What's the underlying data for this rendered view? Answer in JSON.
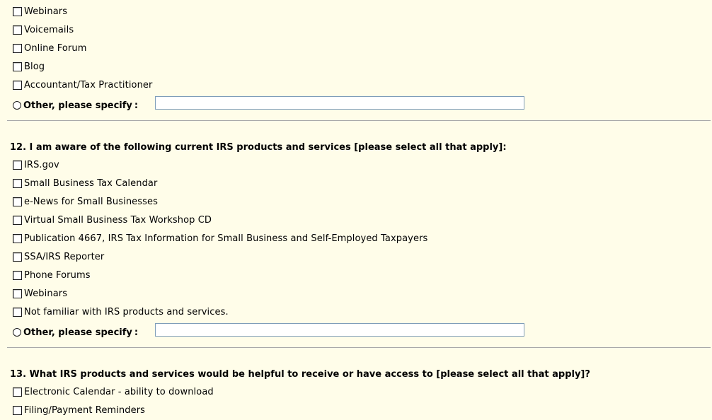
{
  "section_prev": {
    "items": [
      "Webinars",
      "Voicemails",
      "Online Forum",
      "Blog",
      "Accountant/Tax Practitioner"
    ],
    "other_label": "Other, please specify",
    "other_colon": ":",
    "other_value": ""
  },
  "q12": {
    "question": "12. I am aware of the following current IRS products and services [please select all that apply]:",
    "items": [
      "IRS.gov",
      "Small Business Tax Calendar",
      "e-News for Small Businesses",
      "Virtual Small Business Tax Workshop CD",
      "Publication 4667, IRS Tax Information for Small Business and Self-Employed Taxpayers",
      "SSA/IRS Reporter",
      "Phone Forums",
      "Webinars",
      "Not familiar with IRS products and services."
    ],
    "other_label": "Other, please specify",
    "other_colon": ":",
    "other_value": ""
  },
  "q13": {
    "question": "13. What IRS products and services would be helpful to receive or have access to [please select all that apply]?",
    "items": [
      "Electronic Calendar - ability to download",
      "Filing/Payment Reminders"
    ]
  }
}
